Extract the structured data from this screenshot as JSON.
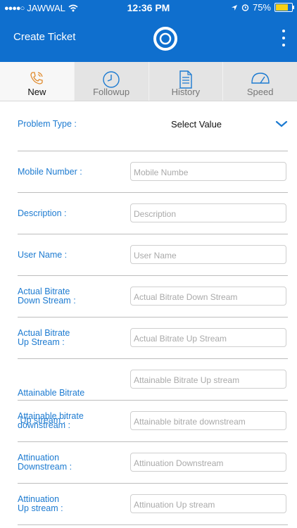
{
  "status": {
    "carrier": "JAWWAL",
    "time": "12:36 PM",
    "battery": "75%",
    "battery_level": 0.75
  },
  "header": {
    "title": "Create Ticket"
  },
  "tabs": [
    {
      "label": "New",
      "icon": "phone-icon"
    },
    {
      "label": "Followup",
      "icon": "clock-icon"
    },
    {
      "label": "History",
      "icon": "document-icon"
    },
    {
      "label": "Speed",
      "icon": "speedometer-icon"
    }
  ],
  "form": {
    "problem_type": {
      "label": "Problem Type :",
      "value": "Select Value"
    },
    "fields": [
      {
        "label": "Mobile Number :",
        "placeholder": "Mobile Numbe"
      },
      {
        "label": "Description :",
        "placeholder": "Description"
      },
      {
        "label": "User Name :",
        "placeholder": "User Name"
      },
      {
        "label_line1": "Actual Bitrate",
        "label_line2": "Down Stream :",
        "placeholder": "Actual Bitrate Down Stream"
      },
      {
        "label_line1": "Actual Bitrate",
        "label_line2": "Up Stream :",
        "placeholder": "Actual Bitrate Up Stream"
      },
      {
        "label_line1": "Attainable Bitrate",
        "label_line2": " Up stream :",
        "placeholder": "Attainable Bitrate Up stream"
      },
      {
        "label_line1": "Attainable bitrate",
        "label_line2": "downstream :",
        "placeholder": "Attainable bitrate downstream"
      },
      {
        "label_line1": "Attinuation",
        "label_line2": "Downstream :",
        "placeholder": "Attinuation Downstream"
      },
      {
        "label_line1": "Attinuation",
        "label_line2": "Up stream :",
        "placeholder": "Attinuation Up stream"
      }
    ]
  },
  "colors": {
    "primary": "#0f6fce",
    "label": "#1d7bd1",
    "battery": "#f7d117"
  }
}
